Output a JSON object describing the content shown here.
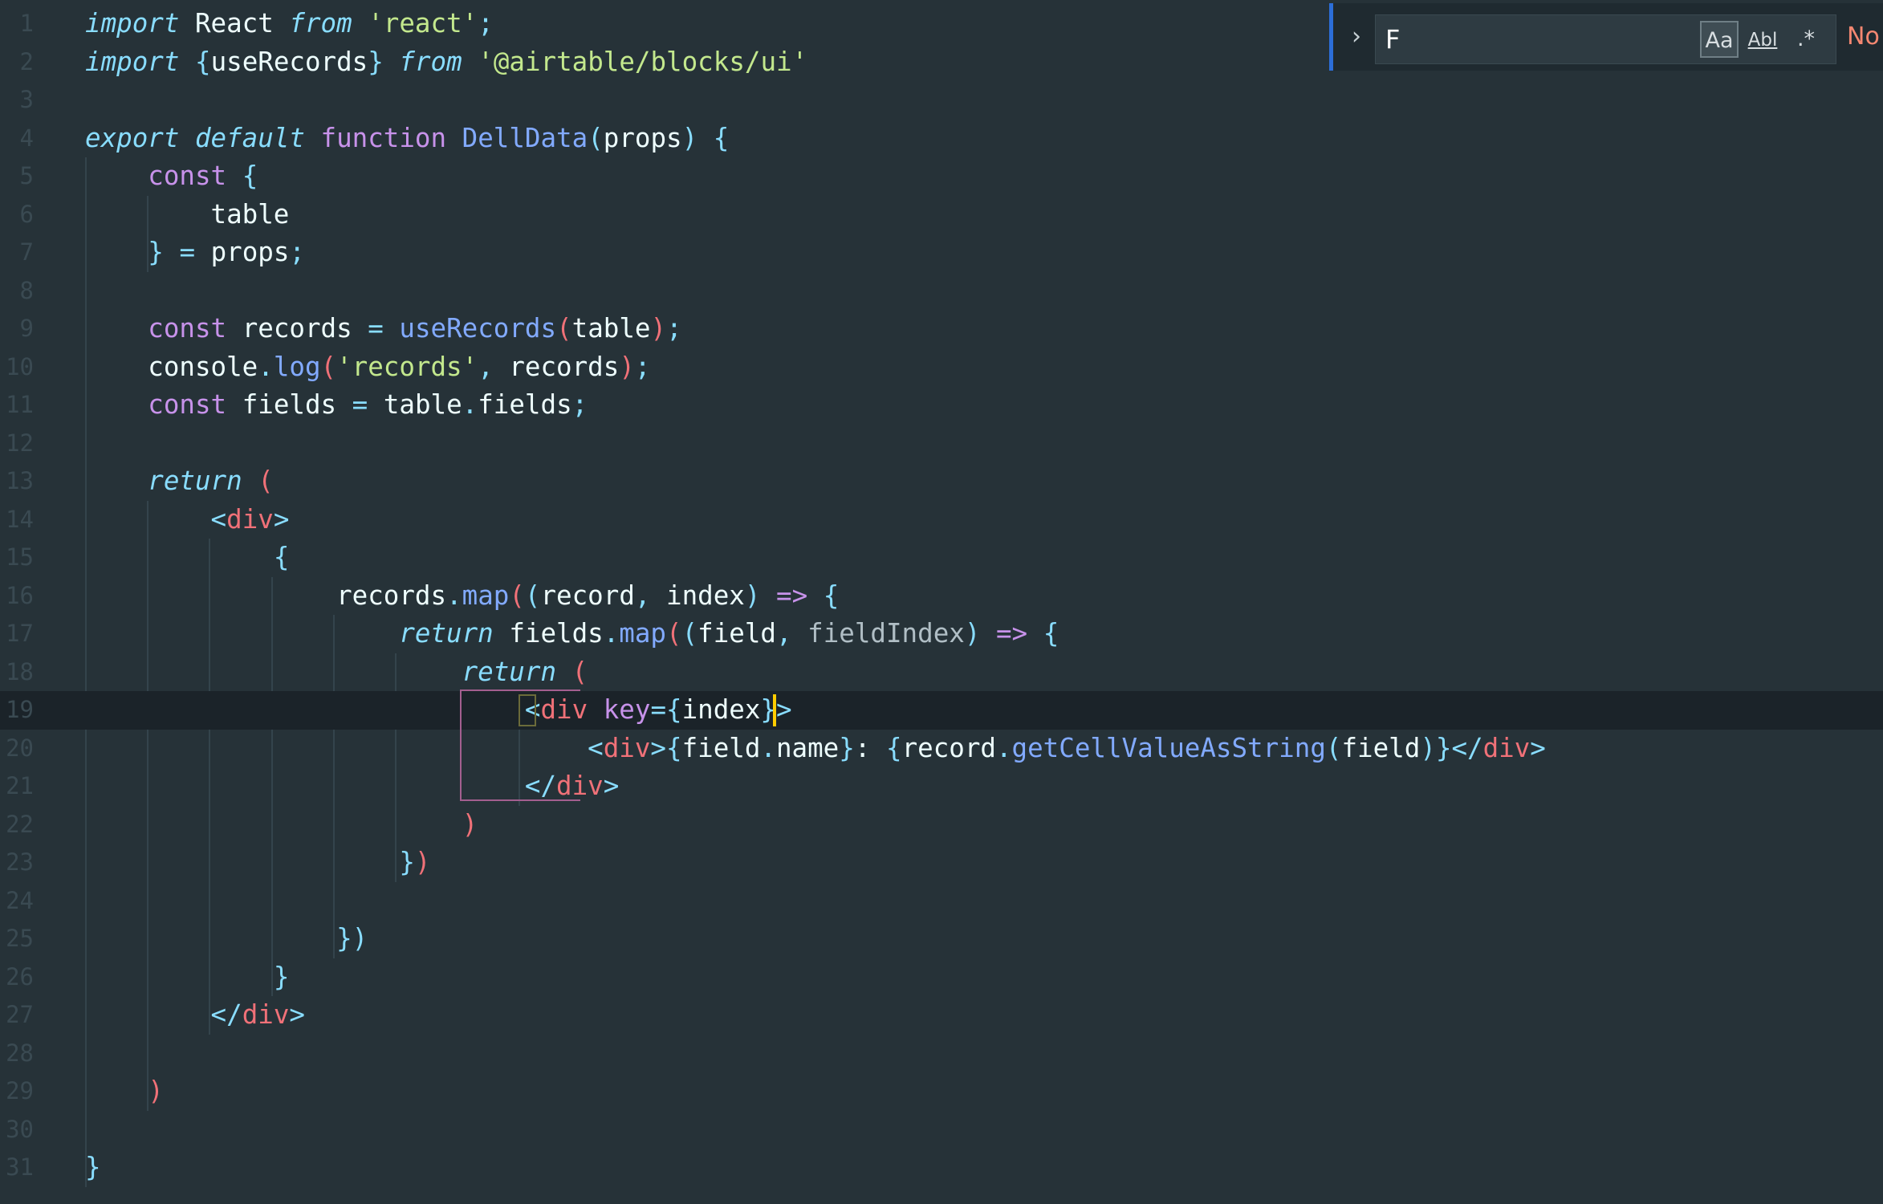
{
  "editor": {
    "lines": [
      {
        "n": "1",
        "tokens": [
          [
            "tok-kwb",
            "import"
          ],
          [
            "tok-plain",
            " React "
          ],
          [
            "tok-kwb",
            "from"
          ],
          [
            "tok-plain",
            " "
          ],
          [
            "tok-str",
            "'react'"
          ],
          [
            "tok-pun",
            ";"
          ]
        ]
      },
      {
        "n": "2",
        "tokens": [
          [
            "tok-kwb",
            "import"
          ],
          [
            "tok-plain",
            " "
          ],
          [
            "tok-pun",
            "{"
          ],
          [
            "tok-plain",
            "useRecords"
          ],
          [
            "tok-pun",
            "}"
          ],
          [
            "tok-plain",
            " "
          ],
          [
            "tok-kwb",
            "from"
          ],
          [
            "tok-plain",
            " "
          ],
          [
            "tok-str",
            "'@airtable/blocks/ui'"
          ]
        ]
      },
      {
        "n": "3",
        "tokens": []
      },
      {
        "n": "4",
        "tokens": [
          [
            "tok-kwb",
            "export"
          ],
          [
            "tok-plain",
            " "
          ],
          [
            "tok-kwb",
            "default"
          ],
          [
            "tok-plain",
            " "
          ],
          [
            "tok-kw",
            "function"
          ],
          [
            "tok-plain",
            " "
          ],
          [
            "tok-fn",
            "DellData"
          ],
          [
            "tok-pun",
            "("
          ],
          [
            "tok-plain",
            "props"
          ],
          [
            "tok-pun",
            ")"
          ],
          [
            "tok-plain",
            " "
          ],
          [
            "tok-pun",
            "{"
          ]
        ]
      },
      {
        "n": "5",
        "tokens": [
          [
            "tok-plain",
            "    "
          ],
          [
            "tok-kw",
            "const"
          ],
          [
            "tok-plain",
            " "
          ],
          [
            "tok-pun",
            "{"
          ]
        ]
      },
      {
        "n": "6",
        "tokens": [
          [
            "tok-plain",
            "        table"
          ]
        ]
      },
      {
        "n": "7",
        "tokens": [
          [
            "tok-plain",
            "    "
          ],
          [
            "tok-pun",
            "}"
          ],
          [
            "tok-plain",
            " "
          ],
          [
            "tok-pun",
            "="
          ],
          [
            "tok-plain",
            " props"
          ],
          [
            "tok-pun",
            ";"
          ]
        ]
      },
      {
        "n": "8",
        "tokens": []
      },
      {
        "n": "9",
        "tokens": [
          [
            "tok-plain",
            "    "
          ],
          [
            "tok-kw",
            "const"
          ],
          [
            "tok-plain",
            " records "
          ],
          [
            "tok-pun",
            "="
          ],
          [
            "tok-plain",
            " "
          ],
          [
            "tok-fn",
            "useRecords"
          ],
          [
            "tok-paren",
            "("
          ],
          [
            "tok-plain",
            "table"
          ],
          [
            "tok-paren",
            ")"
          ],
          [
            "tok-pun",
            ";"
          ]
        ]
      },
      {
        "n": "10",
        "tokens": [
          [
            "tok-plain",
            "    console"
          ],
          [
            "tok-pun",
            "."
          ],
          [
            "tok-fn",
            "log"
          ],
          [
            "tok-paren",
            "("
          ],
          [
            "tok-str",
            "'records'"
          ],
          [
            "tok-pun",
            ","
          ],
          [
            "tok-plain",
            " records"
          ],
          [
            "tok-paren",
            ")"
          ],
          [
            "tok-pun",
            ";"
          ]
        ]
      },
      {
        "n": "11",
        "tokens": [
          [
            "tok-plain",
            "    "
          ],
          [
            "tok-kw",
            "const"
          ],
          [
            "tok-plain",
            " fields "
          ],
          [
            "tok-pun",
            "="
          ],
          [
            "tok-plain",
            " table"
          ],
          [
            "tok-pun",
            "."
          ],
          [
            "tok-plain",
            "fields"
          ],
          [
            "tok-pun",
            ";"
          ]
        ]
      },
      {
        "n": "12",
        "tokens": []
      },
      {
        "n": "13",
        "tokens": [
          [
            "tok-plain",
            "    "
          ],
          [
            "tok-kwit",
            "return"
          ],
          [
            "tok-plain",
            " "
          ],
          [
            "tok-paren",
            "("
          ]
        ]
      },
      {
        "n": "14",
        "tokens": [
          [
            "tok-plain",
            "        "
          ],
          [
            "tok-pun",
            "<"
          ],
          [
            "tok-tag",
            "div"
          ],
          [
            "tok-pun",
            ">"
          ]
        ]
      },
      {
        "n": "15",
        "tokens": [
          [
            "tok-plain",
            "            "
          ],
          [
            "tok-pun",
            "{"
          ]
        ]
      },
      {
        "n": "16",
        "tokens": [
          [
            "tok-plain",
            "                records"
          ],
          [
            "tok-pun",
            "."
          ],
          [
            "tok-fn",
            "map"
          ],
          [
            "tok-paren",
            "("
          ],
          [
            "tok-pun",
            "("
          ],
          [
            "tok-plain",
            "record"
          ],
          [
            "tok-pun",
            ","
          ],
          [
            "tok-plain",
            " index"
          ],
          [
            "tok-pun",
            ")"
          ],
          [
            "tok-plain",
            " "
          ],
          [
            "tok-kw",
            "=>"
          ],
          [
            "tok-plain",
            " "
          ],
          [
            "tok-pun",
            "{"
          ]
        ]
      },
      {
        "n": "17",
        "tokens": [
          [
            "tok-plain",
            "                    "
          ],
          [
            "tok-kwit",
            "return"
          ],
          [
            "tok-plain",
            " fields"
          ],
          [
            "tok-pun",
            "."
          ],
          [
            "tok-fn",
            "map"
          ],
          [
            "tok-paren",
            "("
          ],
          [
            "tok-pun",
            "("
          ],
          [
            "tok-plain",
            "field"
          ],
          [
            "tok-pun",
            ","
          ],
          [
            "tok-plain",
            " "
          ],
          [
            "tok-dim",
            "fieldIndex"
          ],
          [
            "tok-pun",
            ")"
          ],
          [
            "tok-plain",
            " "
          ],
          [
            "tok-kw",
            "=>"
          ],
          [
            "tok-plain",
            " "
          ],
          [
            "tok-pun",
            "{"
          ]
        ]
      },
      {
        "n": "18",
        "tokens": [
          [
            "tok-plain",
            "                        "
          ],
          [
            "tok-kwit",
            "return"
          ],
          [
            "tok-plain",
            " "
          ],
          [
            "tok-paren",
            "("
          ]
        ]
      },
      {
        "n": "19",
        "tokens": [
          [
            "tok-plain",
            "                            "
          ],
          [
            "tok-pun",
            "<"
          ],
          [
            "tok-tag",
            "div"
          ],
          [
            "tok-plain",
            " "
          ],
          [
            "tok-attr",
            "key"
          ],
          [
            "tok-pun",
            "={"
          ],
          [
            "tok-plain",
            "index"
          ],
          [
            "tok-pun",
            "}"
          ],
          [
            "tok-pun",
            ">"
          ]
        ]
      },
      {
        "n": "20",
        "tokens": [
          [
            "tok-plain",
            "                                "
          ],
          [
            "tok-pun",
            "<"
          ],
          [
            "tok-tag",
            "div"
          ],
          [
            "tok-pun",
            ">{"
          ],
          [
            "tok-plain",
            "field"
          ],
          [
            "tok-pun",
            "."
          ],
          [
            "tok-plain",
            "name"
          ],
          [
            "tok-pun",
            "}"
          ],
          [
            "tok-plain",
            ": "
          ],
          [
            "tok-pun",
            "{"
          ],
          [
            "tok-plain",
            "record"
          ],
          [
            "tok-pun",
            "."
          ],
          [
            "tok-fn",
            "getCellValueAsString"
          ],
          [
            "tok-pun",
            "("
          ],
          [
            "tok-plain",
            "field"
          ],
          [
            "tok-pun",
            ")"
          ],
          [
            "tok-pun",
            "}</"
          ],
          [
            "tok-tag",
            "div"
          ],
          [
            "tok-pun",
            ">"
          ]
        ]
      },
      {
        "n": "21",
        "tokens": [
          [
            "tok-plain",
            "                            "
          ],
          [
            "tok-pun",
            "</"
          ],
          [
            "tok-tag",
            "div"
          ],
          [
            "tok-pun",
            ">"
          ]
        ]
      },
      {
        "n": "22",
        "tokens": [
          [
            "tok-plain",
            "                        "
          ],
          [
            "tok-paren",
            ")"
          ]
        ]
      },
      {
        "n": "23",
        "tokens": [
          [
            "tok-plain",
            "                    "
          ],
          [
            "tok-pun",
            "}"
          ],
          [
            "tok-paren",
            ")"
          ]
        ]
      },
      {
        "n": "24",
        "tokens": []
      },
      {
        "n": "25",
        "tokens": [
          [
            "tok-plain",
            "                "
          ],
          [
            "tok-pun",
            "})"
          ]
        ]
      },
      {
        "n": "26",
        "tokens": [
          [
            "tok-plain",
            "            "
          ],
          [
            "tok-pun",
            "}"
          ]
        ]
      },
      {
        "n": "27",
        "tokens": [
          [
            "tok-plain",
            "        "
          ],
          [
            "tok-pun",
            "</"
          ],
          [
            "tok-tag",
            "div"
          ],
          [
            "tok-pun",
            ">"
          ]
        ]
      },
      {
        "n": "28",
        "tokens": []
      },
      {
        "n": "29",
        "tokens": [
          [
            "tok-plain",
            "    "
          ],
          [
            "tok-paren",
            ")"
          ]
        ]
      },
      {
        "n": "30",
        "tokens": []
      },
      {
        "n": "31",
        "tokens": [
          [
            "tok-pun",
            "}"
          ]
        ]
      }
    ],
    "current_line": "19"
  },
  "find_widget": {
    "toggle_icon": "chevron-right-icon",
    "query": "F",
    "match_case_label": "Aa",
    "whole_word_label": "Abl",
    "regex_label": ".*",
    "match_case_active": true,
    "result_text": "No"
  },
  "colors": {
    "background": "#263238",
    "keyword": "#c792ea",
    "string": "#c3e88d",
    "function": "#82aaff",
    "punctuation": "#89ddff",
    "tag": "#f07178",
    "cursor": "#ffcc00",
    "find_border": "#2c6ed8",
    "no_results": "#f48771"
  }
}
